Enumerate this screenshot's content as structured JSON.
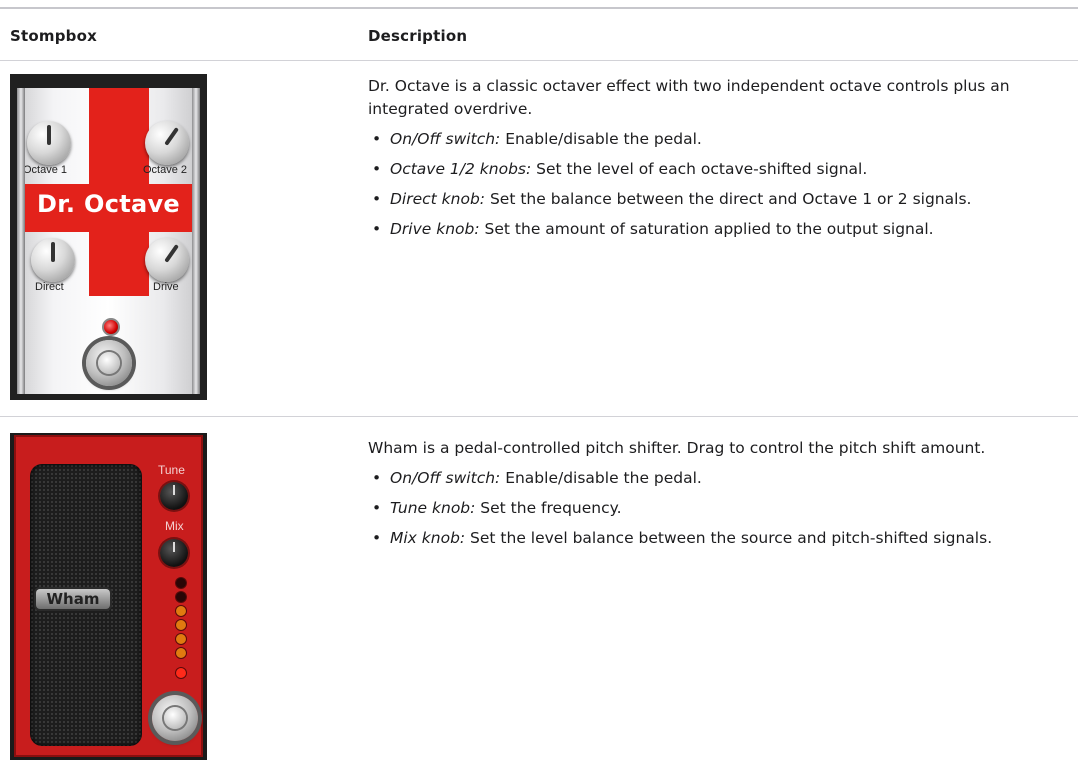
{
  "table": {
    "headers": {
      "col1": "Stompbox",
      "col2": "Description"
    }
  },
  "dr_octave": {
    "pedal": {
      "title": "Dr. Octave",
      "knob_labels": {
        "octave1": "Octave 1",
        "octave2": "Octave 2",
        "direct": "Direct",
        "drive": "Drive"
      }
    },
    "intro": "Dr. Octave is a classic octaver effect with two independent octave controls plus an integrated overdrive.",
    "items": [
      {
        "term": "On/Off switch:",
        "text": " Enable/disable the pedal."
      },
      {
        "term": "Octave 1/2 knobs:",
        "text": " Set the level of each octave-shifted signal."
      },
      {
        "term": "Direct knob:",
        "text": " Set the balance between the direct and Octave 1 or 2 signals."
      },
      {
        "term": "Drive knob:",
        "text": " Set the amount of saturation applied to the output signal."
      }
    ]
  },
  "wham": {
    "pedal": {
      "badge": "Wham",
      "labels": {
        "tune": "Tune",
        "mix": "Mix"
      }
    },
    "intro": "Wham is a pedal-controlled pitch shifter. Drag to control the pitch shift amount.",
    "items": [
      {
        "term": "On/Off switch:",
        "text": " Enable/disable the pedal."
      },
      {
        "term": "Tune knob:",
        "text": " Set the frequency."
      },
      {
        "term": "Mix knob:",
        "text": " Set the level balance between the source and pitch-shifted signals."
      }
    ]
  },
  "colors": {
    "octave_red": "#e3221b",
    "wham_red": "#c81d1d",
    "rule": "#d2d2d7"
  }
}
